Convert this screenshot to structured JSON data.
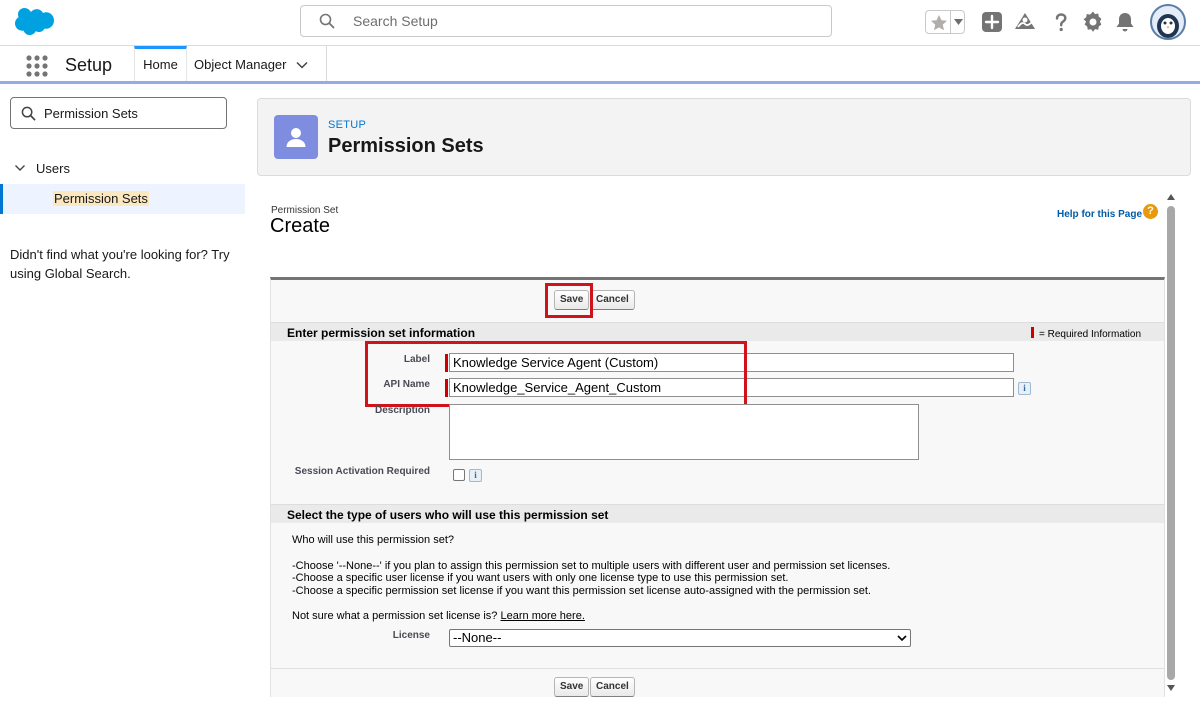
{
  "header": {
    "search_placeholder": "Search Setup"
  },
  "appnav": {
    "app_name": "Setup",
    "tabs": [
      {
        "label": "Home"
      },
      {
        "label": "Object Manager"
      }
    ]
  },
  "sidebar": {
    "quickfind_value": "Permission Sets",
    "tree": {
      "group": "Users",
      "item": "Permission Sets"
    },
    "not_found": "Didn't find what you're looking for? Try using Global Search."
  },
  "page_header": {
    "eyebrow": "SETUP",
    "title": "Permission Sets"
  },
  "form": {
    "object_type": "Permission Set",
    "page_name": "Create",
    "help_link": "Help for this Page",
    "help_icon_glyph": "?",
    "save_label": "Save",
    "cancel_label": "Cancel",
    "section1_title": "Enter permission set information",
    "required_info": "= Required Information",
    "fields": {
      "label_label": "Label",
      "label_value": "Knowledge Service Agent (Custom)",
      "api_name_label": "API Name",
      "api_name_value": "Knowledge_Service_Agent_Custom",
      "description_label": "Description",
      "session_label": "Session Activation Required"
    },
    "info_glyph": "i",
    "section2_title": "Select the type of users who will use this permission set",
    "who_question": "Who will use this permission set?",
    "instructions": [
      "-Choose '--None--' if you plan to assign this permission set to multiple users with different user and permission set licenses.",
      "-Choose a specific user license if you want users with only one license type to use this permission set.",
      "-Choose a specific permission set license if you want this permission set license auto-assigned with the permission set."
    ],
    "not_sure": "Not sure what a permission set license is?",
    "learn_more": "Learn more here.",
    "license_label": "License",
    "license_value": "--None--"
  },
  "colors": {
    "highlight": "#d0121b",
    "brand_blue": "#0176d3",
    "page_icon": "#7f8de1",
    "required": "#cc0000"
  }
}
